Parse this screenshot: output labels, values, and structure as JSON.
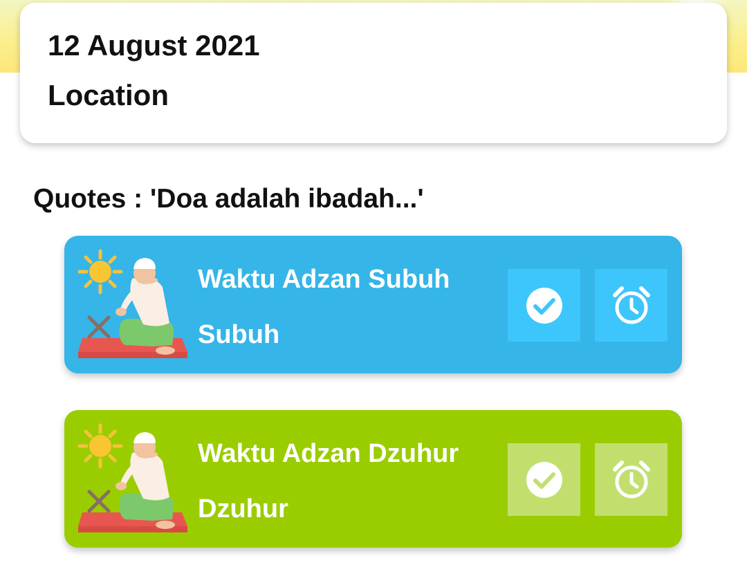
{
  "header": {
    "date": "12 August 2021",
    "location_label": "Location"
  },
  "quote": "Quotes : 'Doa adalah ibadah...'",
  "prayers": [
    {
      "title": "Waktu Adzan Subuh",
      "name": "Subuh",
      "color": "#35b5e8",
      "button_color": "#3dc6fb",
      "icons": [
        "praying-man-illustration",
        "check-circle-icon",
        "alarm-clock-icon"
      ]
    },
    {
      "title": "Waktu Adzan Dzuhur",
      "name": "Dzuhur",
      "color": "#9acd00",
      "button_color": "#c2df6e",
      "icons": [
        "praying-man-illustration",
        "check-circle-icon",
        "alarm-clock-icon"
      ]
    }
  ]
}
